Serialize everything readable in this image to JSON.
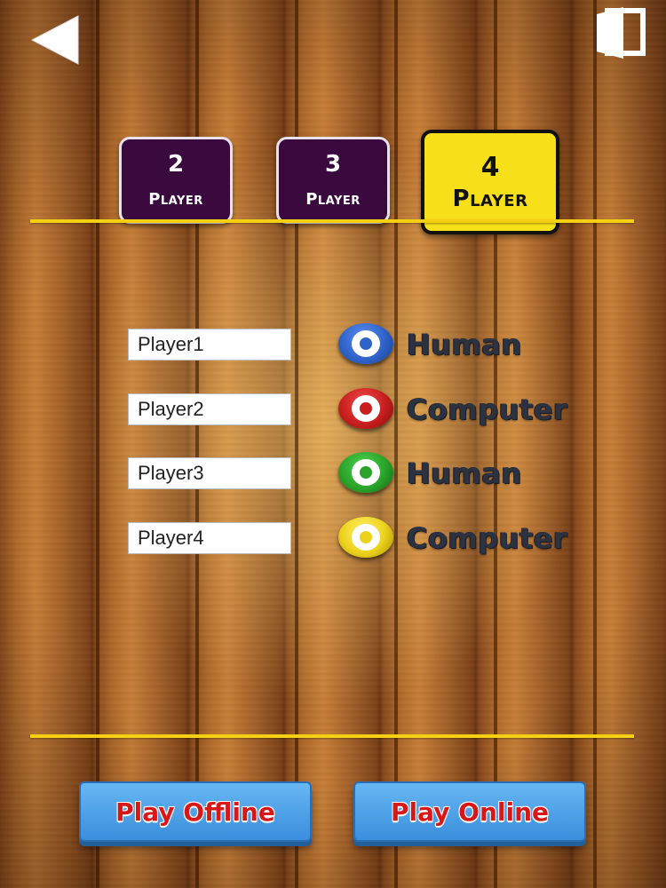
{
  "header": {
    "back_icon": "back-arrow-icon",
    "exit_icon": "exit-door-icon"
  },
  "player_tabs": [
    {
      "number": "2",
      "label": "Player",
      "selected": false
    },
    {
      "number": "3",
      "label": "Player",
      "selected": false
    },
    {
      "number": "4",
      "label": "Player",
      "selected": true
    }
  ],
  "players": [
    {
      "name": "Player1",
      "type": "Human",
      "token_color": "#2f63c8"
    },
    {
      "name": "Player2",
      "type": "Computer",
      "token_color": "#c81e1e"
    },
    {
      "name": "Player3",
      "type": "Human",
      "token_color": "#2aa42a"
    },
    {
      "name": "Player4",
      "type": "Computer",
      "token_color": "#ecd21a"
    }
  ],
  "buttons": {
    "play_offline": "Play Offline",
    "play_online": "Play Online"
  },
  "colors": {
    "divider": "#f4cf12",
    "tab_inactive": "#3a0a3e",
    "tab_active": "#f7e01a",
    "button_blue": "#4a9ee6",
    "button_text_red": "#d81818"
  }
}
